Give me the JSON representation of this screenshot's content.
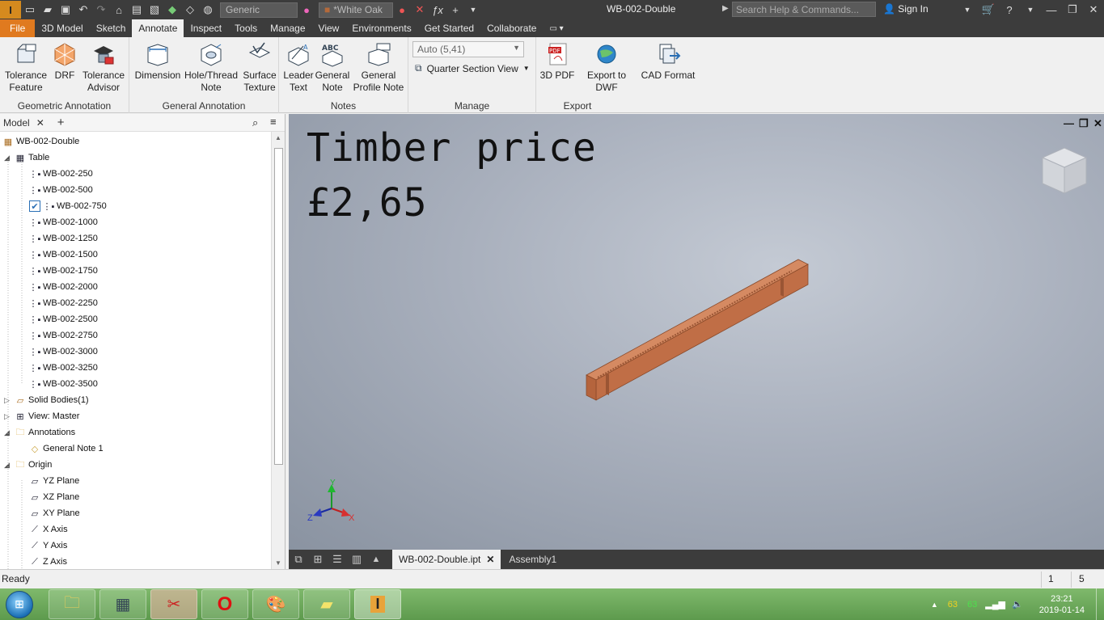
{
  "titlebar": {
    "app_icon": "inventor-pro-logo",
    "appearance_combo": "Generic",
    "material_combo": "*White Oak",
    "title": "WB-002-Double",
    "search_placeholder": "Search Help & Commands...",
    "signin": "Sign In"
  },
  "tabs": [
    "File",
    "3D Model",
    "Sketch",
    "Annotate",
    "Inspect",
    "Tools",
    "Manage",
    "View",
    "Environments",
    "Get Started",
    "Collaborate"
  ],
  "active_tab": "Annotate",
  "ribbon": {
    "geometric_annotation": {
      "label": "Geometric Annotation",
      "buttons": [
        {
          "line1": "Tolerance",
          "line2": "Feature",
          "icon": "tolerance-feature-icon"
        },
        {
          "line1": "DRF",
          "line2": "",
          "icon": "drf-icon"
        },
        {
          "line1": "Tolerance",
          "line2": "Advisor",
          "icon": "tolerance-advisor-icon"
        }
      ]
    },
    "general_annotation": {
      "label": "General Annotation",
      "buttons": [
        {
          "line1": "Dimension",
          "line2": "",
          "icon": "dimension-icon"
        },
        {
          "line1": "Hole/Thread",
          "line2": "Note",
          "icon": "hole-thread-note-icon"
        },
        {
          "line1": "Surface",
          "line2": "Texture",
          "icon": "surface-texture-icon"
        }
      ]
    },
    "notes": {
      "label": "Notes",
      "buttons": [
        {
          "line1": "Leader",
          "line2": "Text",
          "icon": "leader-text-icon"
        },
        {
          "line1": "General",
          "line2": "Note",
          "icon": "general-note-icon"
        },
        {
          "line1": "General",
          "line2": "Profile Note",
          "icon": "general-profile-note-icon"
        }
      ]
    },
    "manage": {
      "label": "Manage",
      "scale_combo": "Auto (5,41)",
      "quarter_section": "Quarter Section View"
    },
    "export": {
      "label": "Export",
      "buttons": [
        {
          "line1": "3D PDF",
          "icon": "pdf-icon"
        },
        {
          "line1": "Export to DWF",
          "icon": "dwf-globe-icon"
        },
        {
          "line1": "CAD Format",
          "icon": "cad-format-icon"
        }
      ]
    }
  },
  "browser": {
    "tab": "Model",
    "root": "WB-002-Double",
    "table_label": "Table",
    "members": [
      "WB-002-250",
      "WB-002-500",
      "WB-002-750",
      "WB-002-1000",
      "WB-002-1250",
      "WB-002-1500",
      "WB-002-1750",
      "WB-002-2000",
      "WB-002-2250",
      "WB-002-2500",
      "WB-002-2750",
      "WB-002-3000",
      "WB-002-3250",
      "WB-002-3500"
    ],
    "active_member": "WB-002-750",
    "solid_bodies": "Solid Bodies(1)",
    "view": "View: Master",
    "annotations": "Annotations",
    "general_note": "General Note 1",
    "origin": "Origin",
    "origin_items": [
      "YZ Plane",
      "XZ Plane",
      "XY Plane",
      "X Axis",
      "Y Axis",
      "Z Axis"
    ]
  },
  "viewport": {
    "note_line1": "Timber price",
    "note_line2": "£2,65",
    "axis_x": "X",
    "axis_y": "Y",
    "axis_z": "Z",
    "model_color": "#c87a52"
  },
  "doctabs": {
    "active": "WB-002-Double.ipt",
    "other": "Assembly1"
  },
  "status": {
    "text": "Ready",
    "count1": "1",
    "count2": "5"
  },
  "taskbar": {
    "tray_a": "63",
    "tray_b": "63",
    "time": "23:21",
    "date": "2019-01-14"
  }
}
